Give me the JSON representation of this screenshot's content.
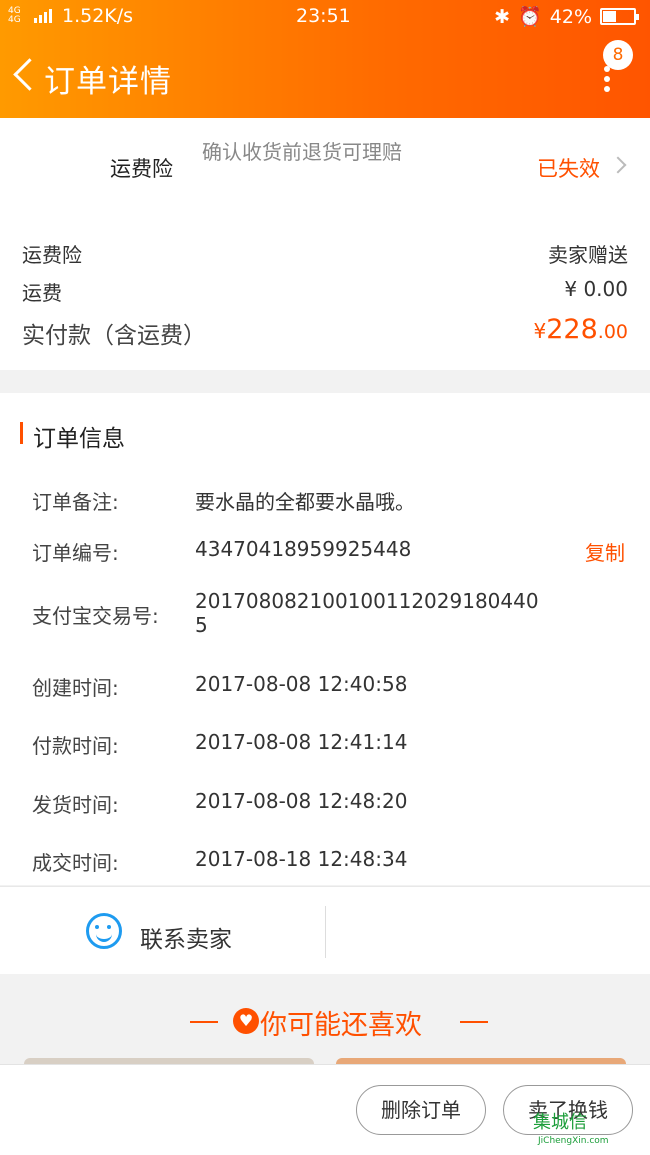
{
  "status_bar": {
    "network": "4G 4G",
    "speed": "1.52K/s",
    "time": "23:51",
    "battery": "42%",
    "battery_fraction": 0.42
  },
  "header": {
    "title": "订单详情",
    "badge_count": "8"
  },
  "shipping_insurance": {
    "label": "运费险",
    "description": "确认收货前退货可理赔",
    "status": "已失效"
  },
  "summary": {
    "insurance_label": "运费险",
    "insurance_value": "卖家赠送",
    "shipping_label": "运费",
    "shipping_value": "¥ 0.00",
    "paid_label": "实付款（含运费）",
    "paid_symbol": "¥",
    "paid_int": "228",
    "paid_dec": ".00"
  },
  "order_info": {
    "title": "订单信息",
    "rows": [
      {
        "key": "订单备注:",
        "value": "要水晶的全都要水晶哦。"
      },
      {
        "key": "订单编号:",
        "value": "43470418959925448"
      },
      {
        "key": "支付宝交易号:",
        "value": "2017080821001001120291804405"
      },
      {
        "key": "创建时间:",
        "value": "2017-08-08 12:40:58"
      },
      {
        "key": "付款时间:",
        "value": "2017-08-08 12:41:14"
      },
      {
        "key": "发货时间:",
        "value": "2017-08-08 12:48:20"
      },
      {
        "key": "成交时间:",
        "value": "2017-08-18 12:48:34"
      }
    ],
    "copy_label": "复制"
  },
  "contact": {
    "label": "联系卖家"
  },
  "recommend": {
    "title": "你可能还喜欢"
  },
  "actions": {
    "delete_label": "删除订单",
    "sell_label": "卖了换钱"
  },
  "watermark": {
    "text": "集城信",
    "sub": "JiChengXin.com"
  },
  "colors": {
    "accent": "#ff5000",
    "header_start": "#ff9a00",
    "header_end": "#ff5500",
    "chat_blue": "#1e9bf0"
  }
}
